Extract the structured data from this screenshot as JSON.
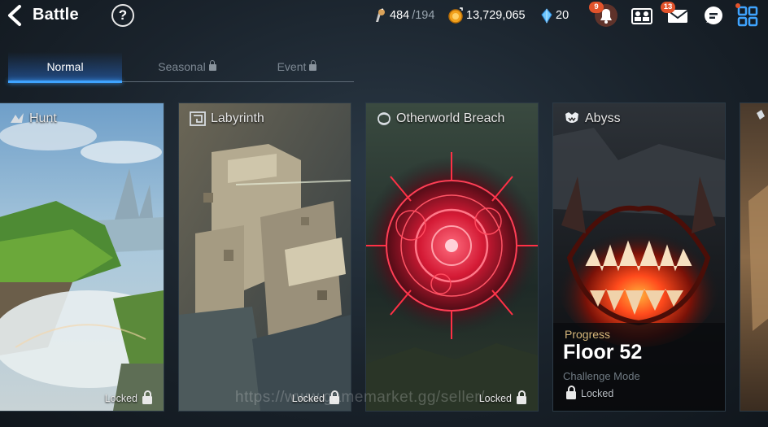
{
  "header": {
    "title": "Battle",
    "help": "?",
    "stamina": {
      "current": "484",
      "max": "/194"
    },
    "gold": "13,729,065",
    "crystals": "20",
    "notifications_badge": "9",
    "mail_badge": "13"
  },
  "tabs": [
    {
      "label": "Normal",
      "active": true
    },
    {
      "label": "Seasonal",
      "locked": true
    },
    {
      "label": "Event",
      "locked": true
    }
  ],
  "cards": {
    "hunt": {
      "name": "Hunt",
      "status": "Locked"
    },
    "labyrinth": {
      "name": "Labyrinth",
      "status": "Locked"
    },
    "breach": {
      "name": "Otherworld Breach",
      "status": "Locked"
    },
    "abyss": {
      "name": "Abyss",
      "progress_label": "Progress",
      "floor": "Floor 52",
      "mode": "Challenge Mode",
      "mode_status": "Locked"
    }
  },
  "watermark": "https://www.gamemarket.gg/seller/...",
  "colors": {
    "accent": "#3fa4ff",
    "badge": "#e2532b",
    "abyss_glow": "#ff4a1c",
    "breach_red": "#ff2440"
  }
}
